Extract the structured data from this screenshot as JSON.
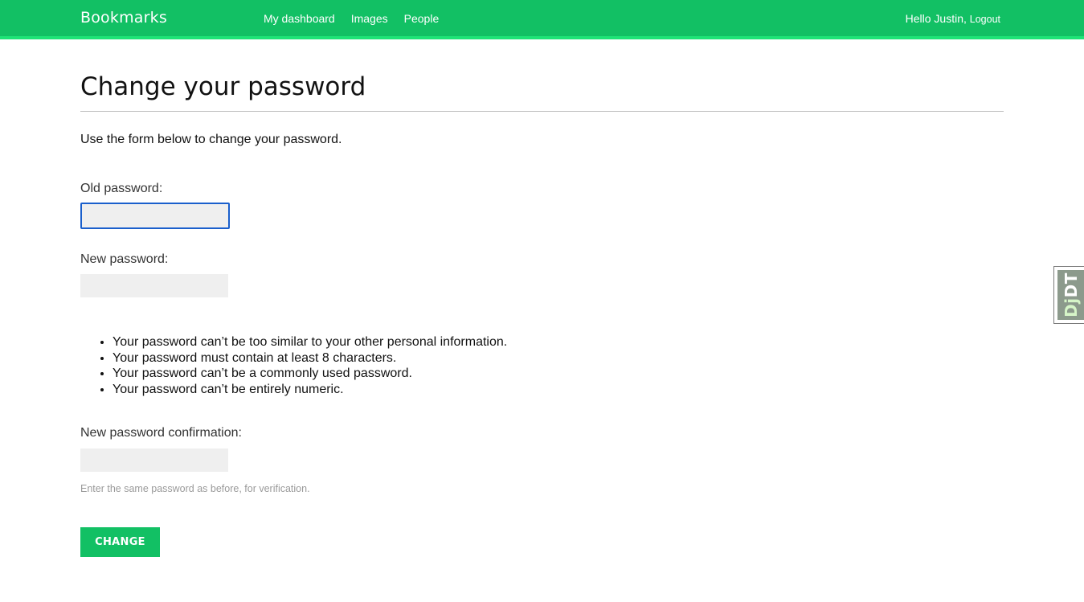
{
  "header": {
    "logo": "Bookmarks",
    "nav": [
      {
        "label": "My dashboard"
      },
      {
        "label": "Images"
      },
      {
        "label": "People"
      }
    ],
    "greeting": "Hello Justin,",
    "logout_label": "Logout"
  },
  "page": {
    "title": "Change your password",
    "intro": "Use the form below to change your password."
  },
  "form": {
    "old_password": {
      "label": "Old password:",
      "value": ""
    },
    "new_password": {
      "label": "New password:",
      "value": ""
    },
    "help_items": [
      "Your password can’t be too similar to your other personal information.",
      "Your password must contain at least 8 characters.",
      "Your password can’t be a commonly used password.",
      "Your password can’t be entirely numeric."
    ],
    "new_password_confirm": {
      "label": "New password confirmation:",
      "value": "",
      "hint": "Enter the same password as before, for verification."
    },
    "submit_label": "CHANGE"
  },
  "debug_toolbar": {
    "handle_prefix": "Dj",
    "handle_suffix": "DT"
  },
  "colors": {
    "brand_green": "#12c064",
    "focus_blue": "#1a5fcc",
    "input_bg": "#efefef"
  },
  "icons": {
    "debug_toolbar_handle": "djdt-icon"
  }
}
